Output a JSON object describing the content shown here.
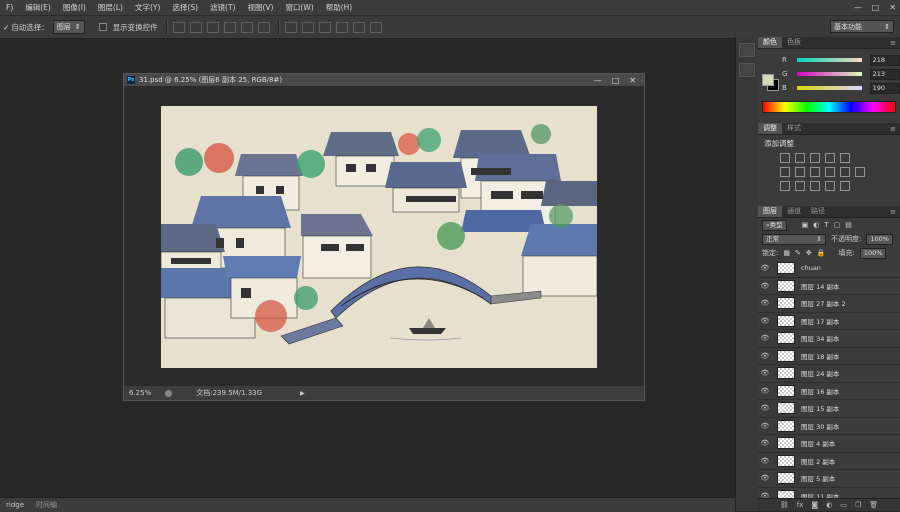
{
  "menubar": {
    "items": [
      "F)",
      "编辑(E)",
      "图像(I)",
      "图层(L)",
      "文字(Y)",
      "选择(S)",
      "滤镜(T)",
      "视图(V)",
      "窗口(W)",
      "帮助(H)"
    ],
    "window_controls": [
      "—",
      "□",
      "✕"
    ]
  },
  "options": {
    "auto_select_label": "自动选择：",
    "auto_select_value": "图层",
    "transform_label": "显示变换控件",
    "workspace": "基本功能"
  },
  "document": {
    "title": "31.psd @ 6.25% (图层6 副本 25, RGB/8#)",
    "zoom": "6.25%",
    "doc_size": "文档:239.5M/1.33G",
    "ps_badge": "Ps",
    "buttons": [
      "—",
      "□",
      "✕"
    ]
  },
  "bottom_tabs": [
    "ridge",
    "时间轴"
  ],
  "color_panel": {
    "tabs": [
      "颜色",
      "色板"
    ],
    "channels": [
      {
        "label": "R",
        "value": "218",
        "color": "#dad5be"
      },
      {
        "label": "G",
        "value": "213"
      },
      {
        "label": "B",
        "value": "190"
      }
    ]
  },
  "adjust_panel": {
    "tabs": [
      "调整",
      "样式"
    ],
    "title": "添加调整"
  },
  "layers_panel": {
    "tabs": [
      "图层",
      "通道",
      "路径"
    ],
    "filter": "类型",
    "blend_mode": "正常",
    "opacity_label": "不透明度:",
    "opacity": "100%",
    "lock_label": "锁定:",
    "fill_label": "填充:",
    "fill": "100%",
    "layers": [
      "chuan",
      "图层 14 副本",
      "图层 27 副本 2",
      "图层 17 副本",
      "图层 34 副本",
      "图层 18 副本",
      "图层 24 副本",
      "图层 16 副本",
      "图层 15 副本",
      "图层 30 副本",
      "图层 4 副本",
      "图层 2 副本",
      "图层 5 副本",
      "图层 11 副本"
    ],
    "footer_icons": [
      "link-icon",
      "fx-icon",
      "mask-icon",
      "adjustment-icon",
      "folder-icon",
      "new-layer-icon",
      "trash-icon"
    ]
  }
}
